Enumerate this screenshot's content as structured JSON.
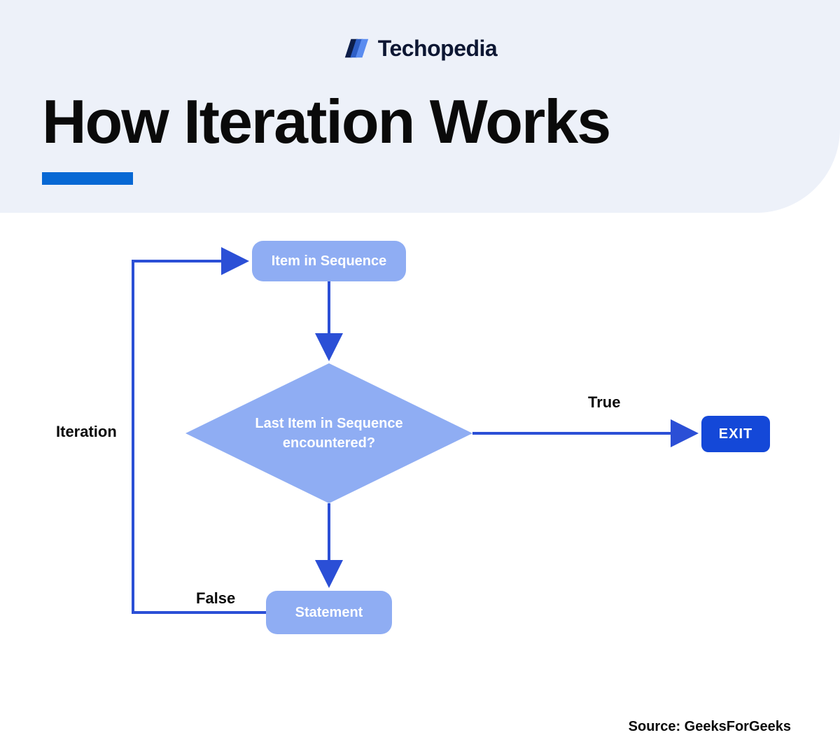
{
  "brand": {
    "name": "Techopedia"
  },
  "title": "How Iteration Works",
  "nodes": {
    "item_in_sequence": "Item in Sequence",
    "decision": "Last Item in Sequence encountered?",
    "statement": "Statement",
    "exit": "EXIT"
  },
  "labels": {
    "true": "True",
    "false": "False",
    "iteration": "Iteration"
  },
  "source": "Source: GeeksForGeeks",
  "colors": {
    "header_bg": "#edf1f9",
    "accent": "#0768d4",
    "node_light": "#8fadf3",
    "node_dark": "#1448d8",
    "arrow": "#2b4fd6"
  }
}
